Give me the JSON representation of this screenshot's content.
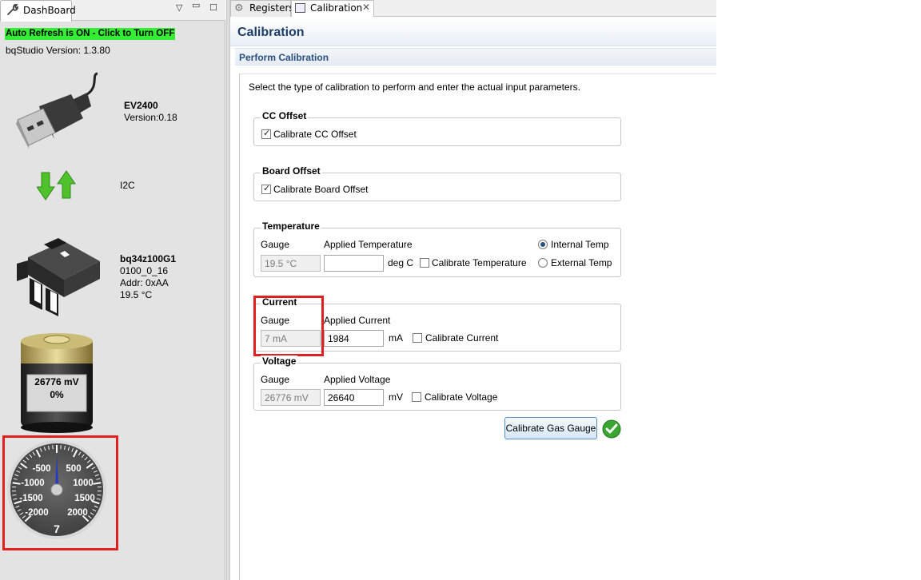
{
  "dashboard": {
    "tab_label": "DashBoard",
    "auto_refresh": "Auto Refresh is ON - Click to Turn OFF",
    "version": "bqStudio Version:  1.3.80",
    "adapter": {
      "name": "EV2400",
      "version": "Version:0.18"
    },
    "bus": "I2C",
    "device": {
      "name": "bq34z100G1",
      "fw": "0100_0_16",
      "addr": "Addr: 0xAA",
      "temp": "19.5 °C"
    },
    "battery": {
      "voltage": "26776 mV",
      "soc": "0%"
    },
    "gauge": {
      "value": "7",
      "ticks": [
        "-500",
        "500",
        "-1000",
        "1000",
        "-1500",
        "1500",
        "-2000",
        "2000"
      ],
      "current_ma": 7,
      "range": [
        -2500,
        2500
      ]
    }
  },
  "tabs": {
    "registers": "Registers",
    "calibration": "Calibration"
  },
  "calibration": {
    "title": "Calibration",
    "section": "Perform Calibration",
    "instructions": "Select the type of calibration to perform and enter the actual input parameters.",
    "cc_offset": {
      "title": "CC Offset",
      "checkbox": "Calibrate CC Offset",
      "checked": true
    },
    "board_offset": {
      "title": "Board Offset",
      "checkbox": "Calibrate Board Offset",
      "checked": true
    },
    "temperature": {
      "title": "Temperature",
      "gauge_label": "Gauge",
      "applied_label": "Applied Temperature",
      "gauge_value": "19.5 °C",
      "applied_value": "",
      "unit": "deg C",
      "checkbox": "Calibrate Temperature",
      "radio_internal": "Internal Temp",
      "radio_external": "External Temp",
      "selected": "internal"
    },
    "current": {
      "title": "Current",
      "gauge_label": "Gauge",
      "applied_label": "Applied Current",
      "gauge_value": "7 mA",
      "applied_value": "1984",
      "unit": "mA",
      "checkbox": "Calibrate Current"
    },
    "voltage": {
      "title": "Voltage",
      "gauge_label": "Gauge",
      "applied_label": "Applied Voltage",
      "gauge_value": "26776 mV",
      "applied_value": "26640",
      "unit": "mV",
      "checkbox": "Calibrate Voltage"
    },
    "button": "Calibrate Gas Gauge"
  },
  "colors": {
    "highlight_red": "#e0201e",
    "refresh_green": "#33ee33",
    "header_blue": "#1d3c66"
  }
}
